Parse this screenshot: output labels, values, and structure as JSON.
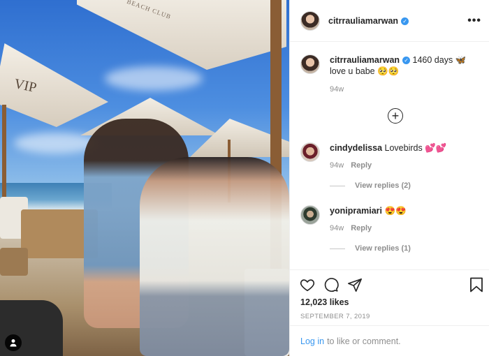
{
  "post": {
    "author": "citrraulia­marwan",
    "author_display": "citrrauliamarwan",
    "verified": true,
    "caption": "1460 days 🦋 love u babe 🥺🥺",
    "caption_time": "94w",
    "load_more_icon": "plus-circle-icon"
  },
  "comments": [
    {
      "username": "cindydelissa",
      "text": "Lovebirds 💕💕",
      "time": "94w",
      "reply_label": "Reply",
      "view_replies": "View replies (2)"
    },
    {
      "username": "yonipramiari",
      "text": "😍😍",
      "time": "94w",
      "reply_label": "Reply",
      "view_replies": "View replies (1)"
    }
  ],
  "actions": {
    "icons": [
      "heart-icon",
      "comment-icon",
      "share-icon",
      "bookmark-icon"
    ],
    "likes": "12,023 likes",
    "date": "SEPTEMBER 7, 2019"
  },
  "footer": {
    "login_link": "Log in",
    "login_text": "to like or comment."
  },
  "photo": {
    "tag_icon": "user-tag-icon",
    "sign_text": "VIP",
    "umbrella_text": "BEACH CLUB"
  },
  "colors": {
    "link_blue": "#3897f0",
    "verified_blue": "#3897f0",
    "text": "#262626",
    "muted": "#8e8e8e"
  }
}
